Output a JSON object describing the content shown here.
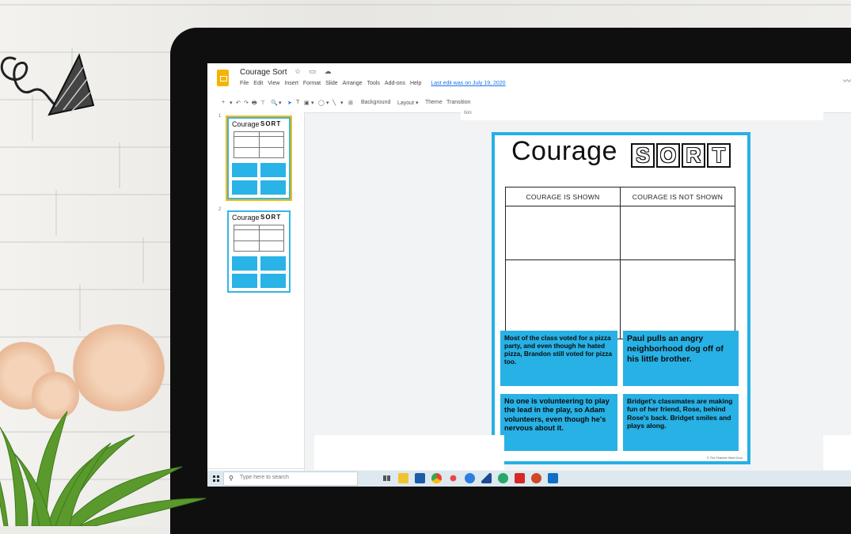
{
  "app": {
    "doc_title": "Courage Sort",
    "menus": [
      "File",
      "Edit",
      "View",
      "Insert",
      "Format",
      "Slide",
      "Arrange",
      "Tools",
      "Add-ons",
      "Help"
    ],
    "last_edit": "Last edit was on July 19, 2020",
    "accent": "#25b0e6"
  },
  "toolbar": {
    "buttons": [
      "+",
      "▾",
      "↶",
      "↷",
      "🖶",
      "⊤",
      "🔍",
      "▾",
      "➤",
      "T",
      "▣",
      "▾",
      "◯",
      "▾",
      "╲",
      "▾",
      "⊞"
    ],
    "background_label": "Background",
    "layout_label": "Layout ▾",
    "theme_label": "Theme",
    "transition_label": "Transition"
  },
  "canvas_hint": "tion",
  "filmstrip": {
    "slides": [
      {
        "number": "1",
        "title": "Courage",
        "sort": "SORT"
      },
      {
        "number": "2",
        "title": "Courage",
        "sort": "SORT"
      }
    ]
  },
  "slide": {
    "title": "Courage",
    "sort_letters": [
      "S",
      "O",
      "R",
      "T"
    ],
    "table_headers": [
      "COURAGE IS SHOWN",
      "COURAGE IS NOT SHOWN"
    ],
    "cards": [
      "Most of the class voted for a pizza party, and even though he hated pizza, Brandon still voted for pizza too.",
      "Paul pulls an angry neighborhood dog off of his little brother.",
      "No one is volunteering to play the lead in the play, so Adam volunteers, even though he's nervous about it.",
      "Bridget's classmates are making fun of her friend, Rose, behind Rose's back. Bridget smiles and plays along."
    ],
    "credit": "© The Teacher Next Door"
  },
  "taskbar": {
    "search_placeholder": "Type here to search",
    "apps": [
      "task-view",
      "file-explorer",
      "mail",
      "chrome",
      "photos",
      "edge",
      "media",
      "chrome-2",
      "acrobat",
      "powerpoint",
      "outlook"
    ]
  }
}
